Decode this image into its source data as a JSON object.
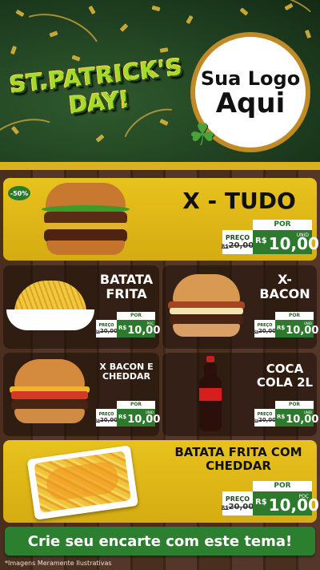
{
  "hero": {
    "event_line1": "ST.PATRICK'S",
    "event_line2": "DAY!",
    "logo_line1": "Sua Logo",
    "logo_line2": "Aqui",
    "clover": "☘"
  },
  "products": [
    {
      "name": "X - TUDO",
      "discount": "-50%",
      "por": "POR",
      "preco": "PREÇO",
      "old_prefix": "R$",
      "old": "20,00",
      "cur": "R$",
      "price": "10,00",
      "unit": "UNID"
    },
    {
      "name": "BATATA FRITA",
      "por": "POR",
      "preco": "PREÇO",
      "old_prefix": "R$",
      "old": "20,00",
      "cur": "R$",
      "price": "10,00",
      "unit": "POÇ"
    },
    {
      "name": "X- BACON",
      "por": "POR",
      "preco": "PREÇO",
      "old_prefix": "R$",
      "old": "20,00",
      "cur": "R$",
      "price": "10,00",
      "unit": "UNID"
    },
    {
      "name": "X BACON E CHEDDAR",
      "por": "POR",
      "preco": "PREÇO",
      "old_prefix": "R$",
      "old": "20,00",
      "cur": "R$",
      "price": "10,00",
      "unit": "UNID"
    },
    {
      "name": "COCA COLA 2L",
      "por": "POR",
      "preco": "PREÇO",
      "old_prefix": "R$",
      "old": "20,00",
      "cur": "R$",
      "price": "10,00",
      "unit": "UNID"
    },
    {
      "name": "BATATA FRITA COM CHEDDAR",
      "por": "POR",
      "preco": "PREÇO",
      "old_prefix": "R$",
      "old": "20,00",
      "cur": "R$",
      "price": "10,00",
      "unit": "POÇ"
    }
  ],
  "cta": "Crie seu encarte com este tema!",
  "footnote": "*Imagens Meramente Ilustrativas",
  "colors": {
    "green": "#2d7a2e",
    "yellow": "#e0b818",
    "wood": "#4a2f1f"
  }
}
